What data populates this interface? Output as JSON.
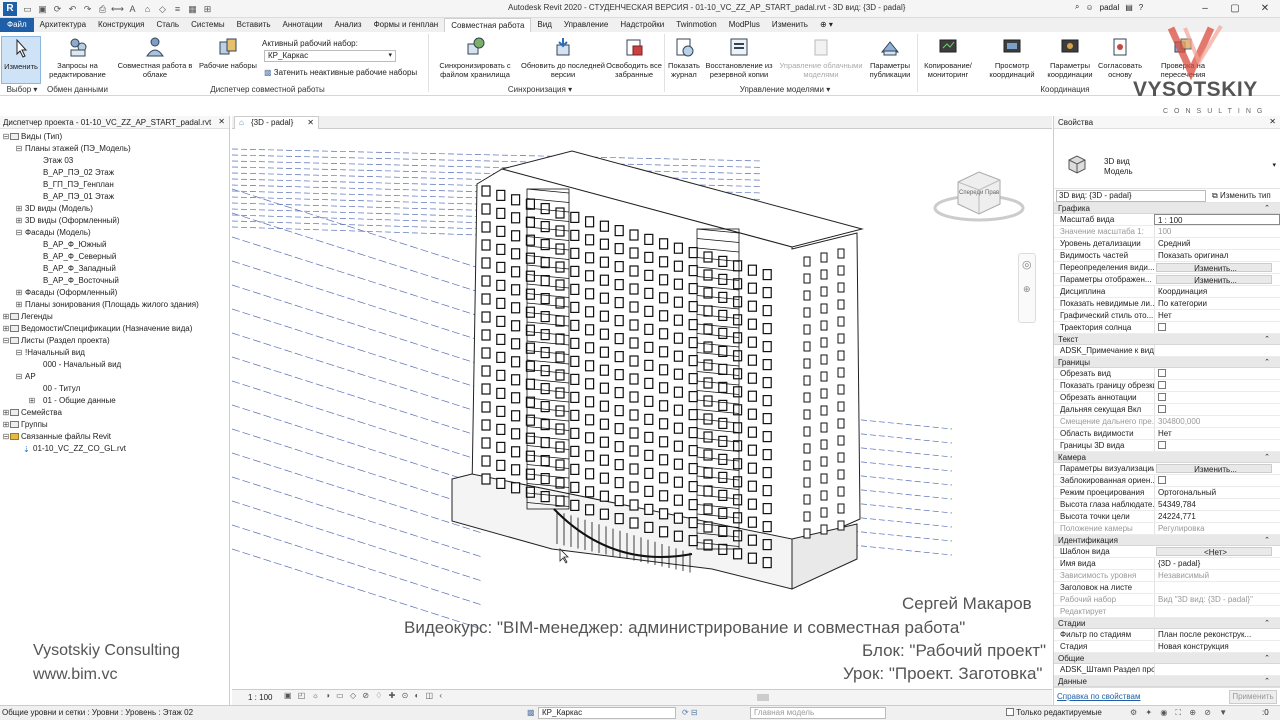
{
  "window": {
    "title": "Autodesk Revit 2020 - СТУДЕНЧЕСКАЯ ВЕРСИЯ - 01-10_VC_ZZ_AP_START_padal.rvt - 3D вид: {3D - padal}",
    "user": "padal"
  },
  "tabs": [
    "Файл",
    "Архитектура",
    "Конструкция",
    "Сталь",
    "Системы",
    "Вставить",
    "Аннотации",
    "Анализ",
    "Формы и генплан",
    "Совместная работа",
    "Вид",
    "Управление",
    "Надстройки",
    "Twinmotion",
    "ModPlus",
    "Изменить"
  ],
  "active_tab": "Совместная работа",
  "ribbon": {
    "modify": "Изменить",
    "requests": "Запросы на редактирование",
    "cloud": "Совместная работа в облаке",
    "worksets": "Рабочие наборы",
    "active_ws_label": "Активный рабочий набор:",
    "active_ws_value": "КР_Каркас",
    "gray_inactive": "Затенить неактивные рабочие наборы",
    "sync": "Синхронизировать с файлом хранилища",
    "reload": "Обновить до последней версии",
    "relinquish": "Освободить все забранные",
    "log": "Показать журнал",
    "restore": "Восстановление из резервной копии",
    "manage_cloud": "Управление облачными моделями",
    "pub_settings": "Параметры публикации",
    "copy_monitor": "Копирование/ мониторинг",
    "coord_review": "Просмотр координаций",
    "coord_settings": "Параметры координации",
    "reconcile": "Согласовать основу",
    "interference": "Проверка на пересечения",
    "panels": {
      "select": "Выбор",
      "exchange": "Обмен данными",
      "ws_manager": "Диспетчер совместной работы",
      "sync": "Синхронизация",
      "model_manage": "Управление моделями",
      "coordination": "Координация"
    }
  },
  "logo": {
    "brand": "VYSOTSKIY",
    "sub": "CONSULTING"
  },
  "project_browser": {
    "title": "Диспетчер проекта - 01-10_VC_ZZ_AP_START_padal.rvt",
    "nodes": [
      {
        "t": "Виды (Тип)",
        "l": 0,
        "g": "−"
      },
      {
        "t": "Планы этажей (ПЭ_Модель)",
        "l": 1,
        "g": "−"
      },
      {
        "t": "Этаж 03",
        "l": 2,
        "g": ""
      },
      {
        "t": "В_АР_ПЭ_02 Этаж",
        "l": 2,
        "g": ""
      },
      {
        "t": "В_ГП_ПЭ_Генплан",
        "l": 2,
        "g": ""
      },
      {
        "t": "В_АР_ПЭ_01 Этаж",
        "l": 2,
        "g": ""
      },
      {
        "t": "3D виды (Модель)",
        "l": 1,
        "g": "+"
      },
      {
        "t": "3D виды (Оформленный)",
        "l": 1,
        "g": "+"
      },
      {
        "t": "Фасады (Модель)",
        "l": 1,
        "g": "−"
      },
      {
        "t": "В_АР_Ф_Южный",
        "l": 2,
        "g": ""
      },
      {
        "t": "В_АР_Ф_Северный",
        "l": 2,
        "g": ""
      },
      {
        "t": "В_АР_Ф_Западный",
        "l": 2,
        "g": ""
      },
      {
        "t": "В_АР_Ф_Восточный",
        "l": 2,
        "g": ""
      },
      {
        "t": "Фасады (Оформленный)",
        "l": 1,
        "g": "+"
      },
      {
        "t": "Планы зонирования (Площадь жилого здания)",
        "l": 1,
        "g": "+"
      },
      {
        "t": "Легенды",
        "l": 0,
        "g": "+"
      },
      {
        "t": "Ведомости/Спецификации (Назначение вида)",
        "l": 0,
        "g": "+"
      },
      {
        "t": "Листы (Раздел проекта)",
        "l": 0,
        "g": "−"
      },
      {
        "t": "!Начальный вид",
        "l": 1,
        "g": "−"
      },
      {
        "t": "000 - Начальный вид",
        "l": 2,
        "g": ""
      },
      {
        "t": "АР",
        "l": 1,
        "g": "−"
      },
      {
        "t": "00 - Титул",
        "l": 2,
        "g": ""
      },
      {
        "t": "01 - Общие данные",
        "l": 2,
        "g": "+"
      },
      {
        "t": "Семейства",
        "l": 0,
        "g": "+"
      },
      {
        "t": "Группы",
        "l": 0,
        "g": "+"
      },
      {
        "t": "Связанные файлы Revit",
        "l": 0,
        "g": "−"
      },
      {
        "t": "01-10_VC_ZZ_CO_GL.rvt",
        "l": 1,
        "g": ""
      }
    ]
  },
  "view_tab": "{3D - padal}",
  "viewcube": {
    "front": "Спереди",
    "right": "Прав"
  },
  "overlay": {
    "author": "Сергей Макаров",
    "course": "Видеокурс: \"BIM-менеджер: администрирование и совместная работа\"",
    "block": "Блок: \"Рабочий проект\"",
    "lesson": "Урок: \"Проект. Заготовка\"",
    "company": "Vysotskiy Consulting",
    "url": "www.bim.vc"
  },
  "view_control": {
    "scale": "1 : 100"
  },
  "properties": {
    "title": "Свойства",
    "type_name1": "3D вид",
    "type_name2": "Модель",
    "selector": "3D вид: {3D - padal}",
    "edit_type": "Изменить тип",
    "sections": [
      {
        "name": "Графика",
        "rows": [
          {
            "k": "Масштаб вида",
            "v": "1 : 100",
            "s": "sel"
          },
          {
            "k": "Значение масштаба    1:",
            "v": "100",
            "s": "dim"
          },
          {
            "k": "Уровень детализации",
            "v": "Средний"
          },
          {
            "k": "Видимость частей",
            "v": "Показать оригинал"
          },
          {
            "k": "Переопределения види...",
            "v": "Изменить...",
            "s": "btn"
          },
          {
            "k": "Параметры отображен...",
            "v": "Изменить...",
            "s": "btn"
          },
          {
            "k": "Дисциплина",
            "v": "Координация"
          },
          {
            "k": "Показать невидимые ли...",
            "v": "По категории"
          },
          {
            "k": "Графический стиль ото...",
            "v": "Нет"
          },
          {
            "k": "Траектория солнца",
            "v": "",
            "s": "chk"
          }
        ]
      },
      {
        "name": "Текст",
        "rows": [
          {
            "k": "ADSK_Примечание к виду",
            "v": ""
          }
        ]
      },
      {
        "name": "Границы",
        "rows": [
          {
            "k": "Обрезать вид",
            "v": "",
            "s": "chk"
          },
          {
            "k": "Показать границу обрезки",
            "v": "",
            "s": "chk"
          },
          {
            "k": "Обрезать аннотации",
            "v": "",
            "s": "chk"
          },
          {
            "k": "Дальняя секущая Вкл",
            "v": "",
            "s": "chk"
          },
          {
            "k": "Смещение дальнего пре...",
            "v": "304800,000",
            "s": "dim"
          },
          {
            "k": "Область видимости",
            "v": "Нет"
          },
          {
            "k": "Границы 3D вида",
            "v": "",
            "s": "chk"
          }
        ]
      },
      {
        "name": "Камера",
        "rows": [
          {
            "k": "Параметры визуализации",
            "v": "Изменить...",
            "s": "btn"
          },
          {
            "k": "Заблокированная ориен...",
            "v": "",
            "s": "chk"
          },
          {
            "k": "Режим проецирования",
            "v": "Ортогональный"
          },
          {
            "k": "Высота глаза наблюдате...",
            "v": "54349,784"
          },
          {
            "k": "Высота точки цели",
            "v": "24224,771"
          },
          {
            "k": "Положение камеры",
            "v": "Регулировка",
            "s": "dim"
          }
        ]
      },
      {
        "name": "Идентификация",
        "rows": [
          {
            "k": "Шаблон вида",
            "v": "<Нет>",
            "s": "btn"
          },
          {
            "k": "Имя вида",
            "v": "{3D - padal}"
          },
          {
            "k": "Зависимость уровня",
            "v": "Независимый",
            "s": "dim"
          },
          {
            "k": "Заголовок на листе",
            "v": ""
          },
          {
            "k": "Рабочий набор",
            "v": "Вид \"3D вид: {3D - padal}\"",
            "s": "dim"
          },
          {
            "k": "Редактирует",
            "v": "",
            "s": "dim"
          }
        ]
      },
      {
        "name": "Стадии",
        "rows": [
          {
            "k": "Фильтр по стадиям",
            "v": "План после реконструк..."
          },
          {
            "k": "Стадия",
            "v": "Новая конструкция"
          }
        ]
      },
      {
        "name": "Общие",
        "rows": [
          {
            "k": "ADSK_Штамп Раздел про...",
            "v": ""
          }
        ]
      },
      {
        "name": "Данные",
        "rows": []
      }
    ],
    "help": "Справка по свойствам",
    "apply": "Применить"
  },
  "status": {
    "left": "Общие уровни и сетки : Уровни : Уровень : Этаж 02",
    "workset": "КР_Каркас",
    "model": "Главная модель",
    "editable": "Только редактируемые",
    "zero": ":0"
  }
}
